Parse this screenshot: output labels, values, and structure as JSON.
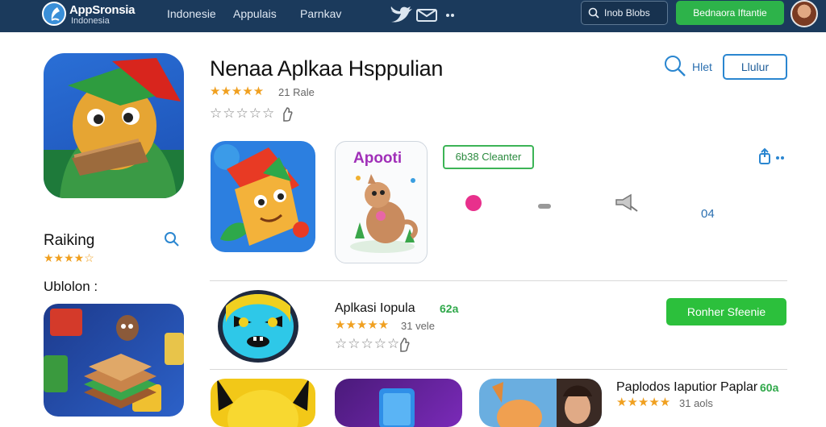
{
  "header": {
    "brand": "AppSronsia",
    "brand_sub": "Indonesia",
    "nav": [
      "Indonesie",
      "Appulais",
      "Parnkav"
    ],
    "search_label": "Inob Blobs",
    "cta_label": "Bednaora Iftantie"
  },
  "hero": {
    "title": "Nenaa Aplkaa Hsppulian",
    "stars": "★★★★★",
    "rating_text": "21 Rale",
    "empty_stars": "☆☆☆☆☆"
  },
  "toolbar": {
    "filter_label": "Hlet",
    "button_label": "Llulur"
  },
  "featured": {
    "card_title": "Apooti",
    "category_button": "6b38 Cleanter",
    "count": "04"
  },
  "sidebar": {
    "title": "Raiking",
    "stars": "★★★★☆",
    "subtitle": "Ublolon :"
  },
  "list": [
    {
      "title": "Aplkasi Iopula",
      "price": "62a",
      "stars": "★★★★★",
      "rating_text": "31 vele",
      "empty_stars": "☆☆☆☆☆",
      "button": "Ronher Sfeenie"
    },
    {
      "title": "Paplodos Iaputior Paplar",
      "price": "60a",
      "stars": "★★★★★",
      "rating_text": "31 aols"
    }
  ],
  "colors": {
    "header_bg": "#1b3a5c",
    "accent_green": "#2cc03c",
    "accent_blue": "#2a86d0",
    "star": "#f0a020"
  }
}
